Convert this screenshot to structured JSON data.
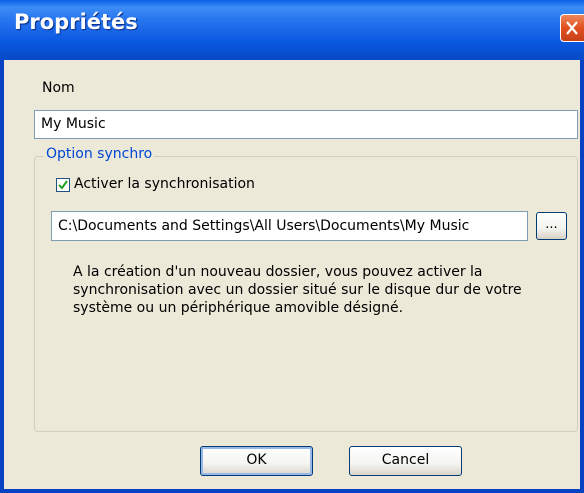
{
  "window": {
    "title": "Propriétés"
  },
  "form": {
    "name_label": "Nom",
    "name_value": "My Music"
  },
  "sync_group": {
    "legend": "Option synchro",
    "checkbox_label": "Activer la synchronisation",
    "checkbox_checked": true,
    "path_value": "C:\\Documents and Settings\\All Users\\Documents\\My Music",
    "browse_label": "...",
    "description": "A la création d'un nouveau dossier, vous pouvez activer la synchronisation avec un dossier situé sur le disque dur de votre système ou un périphérique amovible désigné."
  },
  "buttons": {
    "ok_label": "OK",
    "cancel_label": "Cancel"
  },
  "colors": {
    "titlebar": "#0a58e0",
    "legend_text": "#0046d5",
    "checkmark": "#21a121",
    "close_button": "#e0501e"
  }
}
